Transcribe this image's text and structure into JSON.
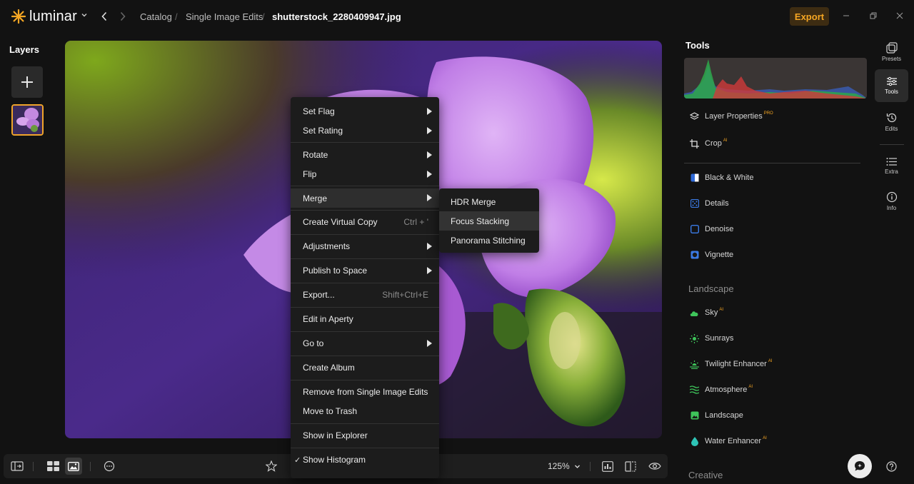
{
  "app": {
    "name": "luminar"
  },
  "breadcrumb": [
    {
      "label": "Catalog"
    },
    {
      "label": "Single Image Edits"
    },
    {
      "label": "shutterstock_2280409947.jpg"
    }
  ],
  "header": {
    "export_label": "Export"
  },
  "layers": {
    "title": "Layers"
  },
  "tools": {
    "title": "Tools",
    "items": [
      {
        "label": "Layer Properties",
        "badge": "PRO",
        "icon": "layers-icon"
      },
      {
        "label": "Crop",
        "badge": "AI",
        "icon": "crop-icon"
      },
      {
        "label": "Black & White",
        "icon": "black-white-icon"
      },
      {
        "label": "Details",
        "icon": "details-icon"
      },
      {
        "label": "Denoise",
        "icon": "denoise-icon"
      },
      {
        "label": "Vignette",
        "icon": "vignette-icon"
      }
    ],
    "landscape_title": "Landscape",
    "landscape_items": [
      {
        "label": "Sky",
        "badge": "AI",
        "icon": "cloud-icon"
      },
      {
        "label": "Sunrays",
        "icon": "sun-icon"
      },
      {
        "label": "Twilight Enhancer",
        "badge": "AI",
        "icon": "sunset-icon"
      },
      {
        "label": "Atmosphere",
        "badge": "AI",
        "icon": "waves-icon"
      },
      {
        "label": "Landscape",
        "icon": "landscape-image-icon"
      },
      {
        "label": "Water Enhancer",
        "badge": "AI",
        "icon": "droplet-icon"
      }
    ],
    "creative_title": "Creative"
  },
  "rail": [
    {
      "label": "Presets",
      "icon": "presets-icon"
    },
    {
      "label": "Tools",
      "icon": "sliders-icon"
    },
    {
      "label": "Edits",
      "icon": "history-icon"
    },
    {
      "label": "Extra",
      "icon": "list-icon"
    },
    {
      "label": "Info",
      "icon": "info-icon"
    }
  ],
  "bottom": {
    "zoom": "125%"
  },
  "context_menu": {
    "items": [
      {
        "label": "Set Flag"
      },
      {
        "label": "Set Rating"
      },
      {
        "label": "Rotate"
      },
      {
        "label": "Flip"
      },
      {
        "label": "Merge"
      },
      {
        "label": "Create Virtual Copy",
        "shortcut": "Ctrl + '"
      },
      {
        "label": "Adjustments"
      },
      {
        "label": "Publish to Space"
      },
      {
        "label": "Export...",
        "shortcut": "Shift+Ctrl+E"
      },
      {
        "label": "Edit in Aperty"
      },
      {
        "label": "Go to"
      },
      {
        "label": "Create Album"
      },
      {
        "label": "Remove from Single Image Edits"
      },
      {
        "label": "Move to Trash"
      },
      {
        "label": "Show in Explorer"
      },
      {
        "label": "Show Histogram",
        "checkmark": "✓"
      }
    ]
  },
  "submenu": {
    "items": [
      {
        "label": "HDR Merge"
      },
      {
        "label": "Focus Stacking"
      },
      {
        "label": "Panorama Stitching"
      }
    ]
  },
  "colors": {
    "accent": "#f5a623",
    "background": "#121212",
    "menu": "#1c1c1c"
  }
}
